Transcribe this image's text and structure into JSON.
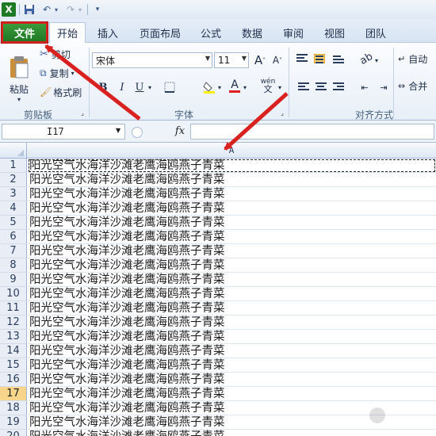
{
  "qat": {
    "icons": [
      "excel-logo-icon",
      "save-icon",
      "undo-icon",
      "redo-icon",
      "customize-qat-icon"
    ]
  },
  "tabs": [
    {
      "label": "文件",
      "active": false,
      "highlighted": true
    },
    {
      "label": "开始",
      "active": true
    },
    {
      "label": "插入",
      "active": false
    },
    {
      "label": "页面布局",
      "active": false
    },
    {
      "label": "公式",
      "active": false
    },
    {
      "label": "数据",
      "active": false
    },
    {
      "label": "审阅",
      "active": false
    },
    {
      "label": "视图",
      "active": false
    },
    {
      "label": "团队",
      "active": false
    }
  ],
  "ribbon": {
    "clipboard": {
      "paste_label": "粘贴",
      "cut_label": "剪切",
      "copy_label": "复制",
      "format_painter_label": "格式刷",
      "group_label": "剪贴板"
    },
    "font": {
      "font_name": "宋体",
      "font_size": "11",
      "bold": "B",
      "italic": "I",
      "underline": "U",
      "grow_label": "A",
      "shrink_label": "A",
      "phonetic_label": "wén",
      "group_label": "字体"
    },
    "alignment": {
      "wrap_label": "自动",
      "merge_label": "合并",
      "group_label": "对齐方式"
    }
  },
  "formula_bar": {
    "name_box": "I17",
    "fx_label": "fx",
    "formula": ""
  },
  "grid": {
    "column_header": "A",
    "selected_row": 17,
    "rows": [
      {
        "num": "1",
        "text": "阳光空气水海洋沙滩老鹰海鸥燕子青菜"
      },
      {
        "num": "2",
        "text": "阳光空气水海洋沙滩老鹰海鸥燕子青菜"
      },
      {
        "num": "3",
        "text": "阳光空气水海洋沙滩老鹰海鸥燕子青菜"
      },
      {
        "num": "4",
        "text": "阳光空气水海洋沙滩老鹰海鸥燕子青菜"
      },
      {
        "num": "5",
        "text": "阳光空气水海洋沙滩老鹰海鸥燕子青菜"
      },
      {
        "num": "6",
        "text": "阳光空气水海洋沙滩老鹰海鸥燕子青菜"
      },
      {
        "num": "7",
        "text": "阳光空气水海洋沙滩老鹰海鸥燕子青菜"
      },
      {
        "num": "8",
        "text": "阳光空气水海洋沙滩老鹰海鸥燕子青菜"
      },
      {
        "num": "9",
        "text": "阳光空气水海洋沙滩老鹰海鸥燕子青菜"
      },
      {
        "num": "10",
        "text": "阳光空气水海洋沙滩老鹰海鸥燕子青菜"
      },
      {
        "num": "11",
        "text": "阳光空气水海洋沙滩老鹰海鸥燕子青菜"
      },
      {
        "num": "12",
        "text": "阳光空气水海洋沙滩老鹰海鸥燕子青菜"
      },
      {
        "num": "13",
        "text": "阳光空气水海洋沙滩老鹰海鸥燕子青菜"
      },
      {
        "num": "14",
        "text": "阳光空气水海洋沙滩老鹰海鸥燕子青菜"
      },
      {
        "num": "15",
        "text": "阳光空气水海洋沙滩老鹰海鸥燕子青菜"
      },
      {
        "num": "16",
        "text": "阳光空气水海洋沙滩老鹰海鸥燕子青菜"
      },
      {
        "num": "17",
        "text": "阳光空气水海洋沙滩老鹰海鸥燕子青菜"
      },
      {
        "num": "18",
        "text": "阳光空气水海洋沙滩老鹰海鸥燕子青菜"
      },
      {
        "num": "19",
        "text": "阳光空气水海洋沙滩老鹰海鸥燕子青菜"
      },
      {
        "num": "20",
        "text": "阳光空气水海洋沙滩老鹰海鸥燕子青菜"
      }
    ]
  },
  "colors": {
    "file_tab": "#2a8a2e",
    "annotation_red": "#d9211f",
    "selected_row_header": "#f7d68c"
  }
}
